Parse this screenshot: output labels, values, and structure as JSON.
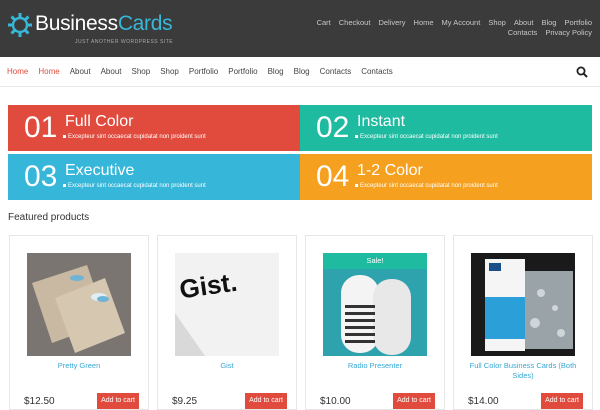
{
  "brand": {
    "name_part1": "Business",
    "name_part2": "Cards",
    "tagline": "JUST ANOTHER WORDPRESS SITE"
  },
  "top_nav": [
    "Cart",
    "Checkout",
    "Delivery",
    "Home",
    "My Account",
    "Shop",
    "About",
    "Blog",
    "Portfolio",
    "Contacts",
    "Privacy Policy"
  ],
  "main_nav": [
    "Home",
    "Home",
    "About",
    "About",
    "Shop",
    "Shop",
    "Portfolio",
    "Portfolio",
    "Blog",
    "Blog",
    "Contacts",
    "Contacts"
  ],
  "main_nav_active": [
    0,
    1
  ],
  "features": [
    {
      "num": "01",
      "title": "Full Color",
      "desc": "Excepteur sint occaecat cupidatat non proident sunt",
      "color": "#e14b3e"
    },
    {
      "num": "02",
      "title": "Instant",
      "desc": "Excepteur sint occaecat cupidatat non proident sunt",
      "color": "#1ebba1"
    },
    {
      "num": "03",
      "title": "Executive",
      "desc": "Excepteur sint occaecat cupidatat non proident sunt",
      "color": "#36b6d9"
    },
    {
      "num": "04",
      "title": "1-2 Color",
      "desc": "Excepteur sint occaecat cupidatat non proident sunt",
      "color": "#f5a01e"
    }
  ],
  "featured_heading": "Featured products",
  "products": [
    {
      "name": "Pretty Green",
      "price": "$12.50",
      "button": "Add to cart"
    },
    {
      "name": "Gist",
      "price": "$9.25",
      "button": "Add to cart",
      "image_text": "Gist."
    },
    {
      "name": "Radio Presenter",
      "price": "$10.00",
      "button": "Add to cart",
      "badge": "Sale!"
    },
    {
      "name": "Full Color Business Cards (Both Sides)",
      "price": "$14.00",
      "button": "Add to cart"
    }
  ],
  "colors": {
    "accent": "#37b8d8",
    "header_bg": "#3b3b3b",
    "active_link": "#e14b3b",
    "link": "#37a7d4"
  },
  "icons": {
    "logo": "gear-icon",
    "search": "search-icon"
  }
}
